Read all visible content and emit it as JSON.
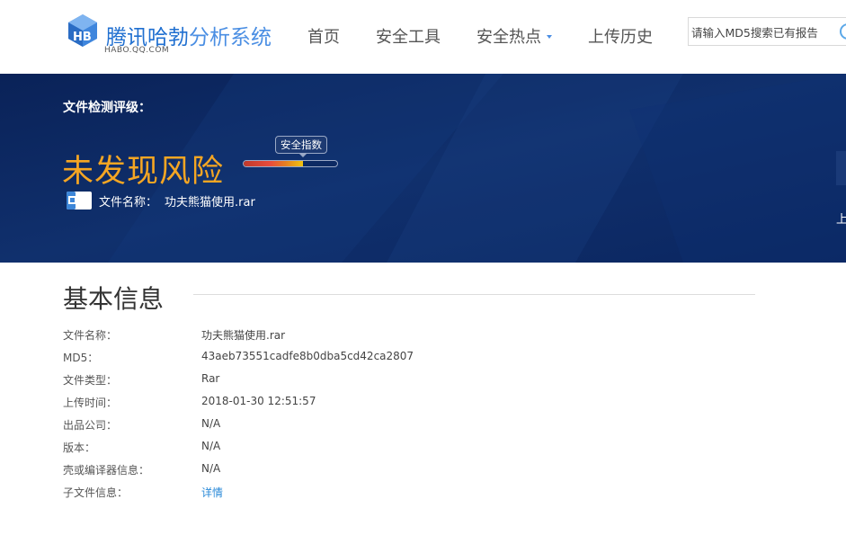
{
  "header": {
    "logo_title_main": "腾讯哈勃",
    "logo_title_light": "分析系统",
    "logo_sub": "HABO.QQ.COM",
    "nav": [
      {
        "label": "首页"
      },
      {
        "label": "安全工具"
      },
      {
        "label": "安全热点",
        "has_dropdown": true
      },
      {
        "label": "上传历史"
      }
    ],
    "search": {
      "placeholder": "请输入MD5搜索已有报告",
      "icon": "search-icon"
    }
  },
  "banner": {
    "rating_label": "文件检测评级：",
    "rating_value": "未发现风险",
    "meter_label": "安全指数",
    "meter_fraction": 0.63,
    "file_name_label": "文件名称：",
    "file_name_value": "功夫熊猫使用.rar",
    "side_char": "上",
    "colors": {
      "background": "#0d2a63",
      "rating": "#f5a623"
    }
  },
  "basic_info": {
    "title": "基本信息",
    "rows": [
      {
        "key": "文件名称：",
        "value": "功夫熊猫使用.rar"
      },
      {
        "key": "MD5：",
        "value": "43aeb73551cadfe8b0dba5cd42ca2807"
      },
      {
        "key": "文件类型：",
        "value": "Rar"
      },
      {
        "key": "上传时间：",
        "value": "2018-01-30 12:51:57"
      },
      {
        "key": "出品公司：",
        "value": "N/A"
      },
      {
        "key": "版本：",
        "value": "N/A"
      },
      {
        "key": "壳或编译器信息：",
        "value": "N/A"
      },
      {
        "key": "子文件信息：",
        "value": "详情",
        "link": true
      }
    ]
  }
}
